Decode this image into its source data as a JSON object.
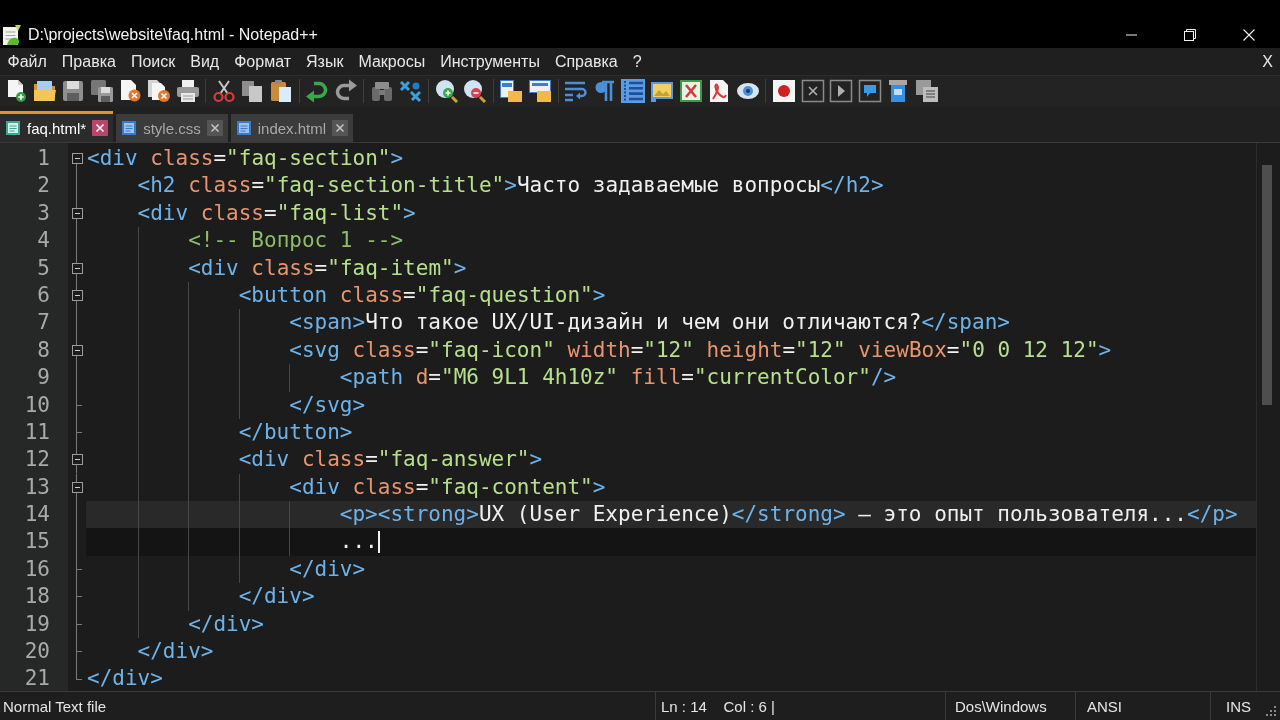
{
  "window": {
    "title": "D:\\projects\\website\\faq.html - Notepad++"
  },
  "menu": {
    "items": [
      "Файл",
      "Правка",
      "Поиск",
      "Вид",
      "Формат",
      "Язык",
      "Макросы",
      "Инструменты",
      "Справка",
      "?"
    ],
    "close_document": "X"
  },
  "toolbar": [
    {
      "buttons": [
        {
          "kind": "newfile",
          "on": false
        },
        {
          "kind": "folder",
          "on": false
        },
        {
          "kind": "save",
          "on": false
        },
        {
          "kind": "saveall",
          "on": false
        },
        {
          "kind": "closefile",
          "on": false
        },
        {
          "kind": "closeall",
          "on": false
        },
        {
          "kind": "print",
          "on": false
        }
      ]
    },
    {
      "buttons": [
        {
          "kind": "cut",
          "on": false
        },
        {
          "kind": "copy",
          "on": false
        },
        {
          "kind": "paste",
          "on": false
        }
      ]
    },
    {
      "buttons": [
        {
          "kind": "undo",
          "on": false
        },
        {
          "kind": "redo",
          "on": false
        }
      ]
    },
    {
      "buttons": [
        {
          "kind": "find",
          "on": false
        },
        {
          "kind": "replace",
          "on": false
        }
      ]
    },
    {
      "buttons": [
        {
          "kind": "zoomin",
          "on": false
        },
        {
          "kind": "zoomout",
          "on": false
        }
      ]
    },
    {
      "buttons": [
        {
          "kind": "syncv",
          "on": false
        },
        {
          "kind": "synch",
          "on": false
        }
      ]
    },
    {
      "buttons": [
        {
          "kind": "wrap",
          "on": false
        },
        {
          "kind": "pilcrow",
          "on": false
        },
        {
          "kind": "indentguide",
          "on": true
        },
        {
          "kind": "image",
          "on": false
        },
        {
          "kind": "sheet",
          "on": false
        },
        {
          "kind": "pdf",
          "on": false
        },
        {
          "kind": "eye",
          "on": false
        }
      ]
    },
    {
      "buttons": [
        {
          "kind": "record",
          "on": false
        },
        {
          "kind": "stop",
          "on": false
        },
        {
          "kind": "play",
          "on": false
        },
        {
          "kind": "playmulti",
          "on": false
        },
        {
          "kind": "savemacro",
          "on": false
        },
        {
          "kind": "windows",
          "on": false
        }
      ]
    }
  ],
  "tabs": [
    {
      "label": "faq.html*",
      "selected": true
    },
    {
      "label": "style.css",
      "selected": false
    },
    {
      "label": "index.html",
      "selected": false
    }
  ],
  "editor": {
    "lines": [
      {
        "number": "1",
        "text": "<div class=\"faq-section\">",
        "highlighted": false,
        "caret": false
      },
      {
        "number": "2",
        "text": "    <h2 class=\"faq-section-title\">Часто задаваемые вопросы</h2>",
        "highlighted": false,
        "caret": false
      },
      {
        "number": "3",
        "text": "    <div class=\"faq-list\">",
        "highlighted": false,
        "caret": false
      },
      {
        "number": "4",
        "text": "        <!-- Вопрос 1 -->",
        "highlighted": false,
        "caret": false
      },
      {
        "number": "5",
        "text": "        <div class=\"faq-item\">",
        "highlighted": false,
        "caret": false
      },
      {
        "number": "6",
        "text": "            <button class=\"faq-question\">",
        "highlighted": false,
        "caret": false
      },
      {
        "number": "7",
        "text": "                <span>Что такое UX/UI-дизайн и чем они отличаются?</span>",
        "highlighted": false,
        "caret": false
      },
      {
        "number": "8",
        "text": "                <svg class=\"faq-icon\" width=\"12\" height=\"12\" viewBox=\"0 0 12 12\">",
        "highlighted": false,
        "caret": false
      },
      {
        "number": "9",
        "text": "                    <path d=\"M6 9L1 4h10z\" fill=\"currentColor\"/>",
        "highlighted": false,
        "caret": false
      },
      {
        "number": "10",
        "text": "                </svg>",
        "highlighted": false,
        "caret": false
      },
      {
        "number": "11",
        "text": "            </button>",
        "highlighted": false,
        "caret": false
      },
      {
        "number": "12",
        "text": "            <div class=\"faq-answer\">",
        "highlighted": false,
        "caret": false
      },
      {
        "number": "13",
        "text": "                <div class=\"faq-content\">",
        "highlighted": false,
        "caret": false
      },
      {
        "number": "14",
        "text": "                    <p><strong>UX (User Experience)</strong> — это опыт пользователя...</p>",
        "highlighted": true,
        "caret": false
      },
      {
        "number": "15",
        "text": "                    ...",
        "highlighted": false,
        "caret": true
      },
      {
        "number": "16",
        "text": "                </div>",
        "highlighted": false,
        "caret": false
      },
      {
        "number": "18",
        "text": "            </div>",
        "highlighted": false,
        "caret": false
      },
      {
        "number": "19",
        "text": "        </div>",
        "highlighted": false,
        "caret": false
      },
      {
        "number": "20",
        "text": "    </div>",
        "highlighted": false,
        "caret": false
      },
      {
        "number": "21",
        "text": "</div>",
        "highlighted": false,
        "caret": false
      }
    ]
  },
  "status_bar": {
    "file_type": "Normal Text file",
    "position": "Ln : 14    Col : 6 |",
    "line_endings": "Dos\\Windows",
    "encoding": "ANSI",
    "mode": "INS"
  }
}
